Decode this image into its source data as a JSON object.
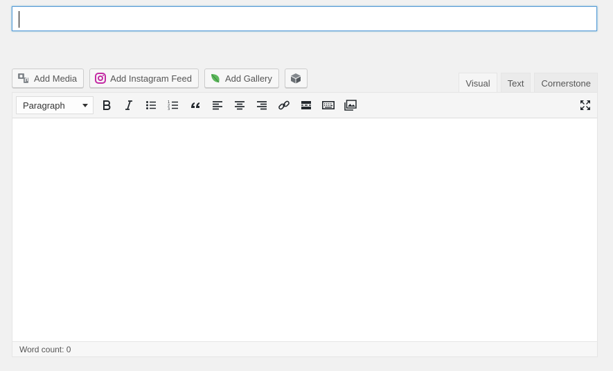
{
  "title_field": {
    "value": "",
    "placeholder": ""
  },
  "media_buttons": {
    "add_media": "Add Media",
    "add_instagram_feed": "Add Instagram Feed",
    "add_gallery": "Add Gallery"
  },
  "editor_tabs": {
    "visual": "Visual",
    "text": "Text",
    "cornerstone": "Cornerstone"
  },
  "toolbar": {
    "format_select": "Paragraph",
    "buttons": [
      "bold",
      "italic",
      "bulleted-list",
      "numbered-list",
      "blockquote",
      "align-left",
      "align-center",
      "align-right",
      "insert-link",
      "read-more",
      "toolbar-toggle",
      "add-image",
      "fullscreen"
    ]
  },
  "status": {
    "word_count": "Word count: 0"
  },
  "colors": {
    "accent_focus": "#5b9dd9",
    "gallery_leaf": "#5cb85c",
    "instagram": "#c32aa3"
  }
}
